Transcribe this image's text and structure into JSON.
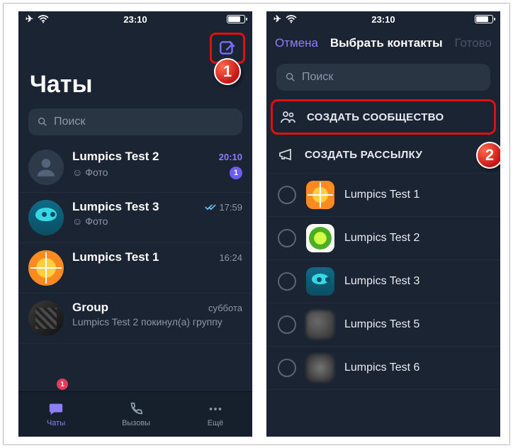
{
  "status": {
    "time": "23:10"
  },
  "marker1": "1",
  "marker2": "2",
  "left": {
    "title": "Чаты",
    "search_placeholder": "Поиск",
    "chats": [
      {
        "name": "Lumpics Test 2",
        "sub_prefix": "☺",
        "sub": "Фото",
        "time": "20:10",
        "unread": "1",
        "accent": true,
        "avatar": "person"
      },
      {
        "name": "Lumpics Test 3",
        "sub_prefix": "☺",
        "sub": "Фото",
        "time": "17:59",
        "read": true,
        "avatar": "cyan"
      },
      {
        "name": "Lumpics Test 1",
        "sub": "",
        "time": "16:24",
        "avatar": "orange"
      },
      {
        "name": "Group",
        "sub": "Lumpics Test 2 покинул(а) группу",
        "time": "суббота",
        "avatar": "grp"
      }
    ],
    "tabs": {
      "chats": "Чаты",
      "chats_badge": "1",
      "calls": "Вызовы",
      "more": "Ещё"
    }
  },
  "right": {
    "cancel": "Отмена",
    "title": "Выбрать контакты",
    "done": "Готово",
    "search_placeholder": "Поиск",
    "create_community": "СОЗДАТЬ СООБЩЕСТВО",
    "create_broadcast": "СОЗДАТЬ РАССЫЛКУ",
    "contacts": [
      {
        "name": "Lumpics Test 1",
        "avatar": "orange"
      },
      {
        "name": "Lumpics Test 2",
        "avatar": "lime"
      },
      {
        "name": "Lumpics Test 3",
        "avatar": "cyan"
      },
      {
        "name": "Lumpics Test 5",
        "avatar": "blur1"
      },
      {
        "name": "Lumpics Test 6",
        "avatar": "blur2"
      }
    ]
  }
}
